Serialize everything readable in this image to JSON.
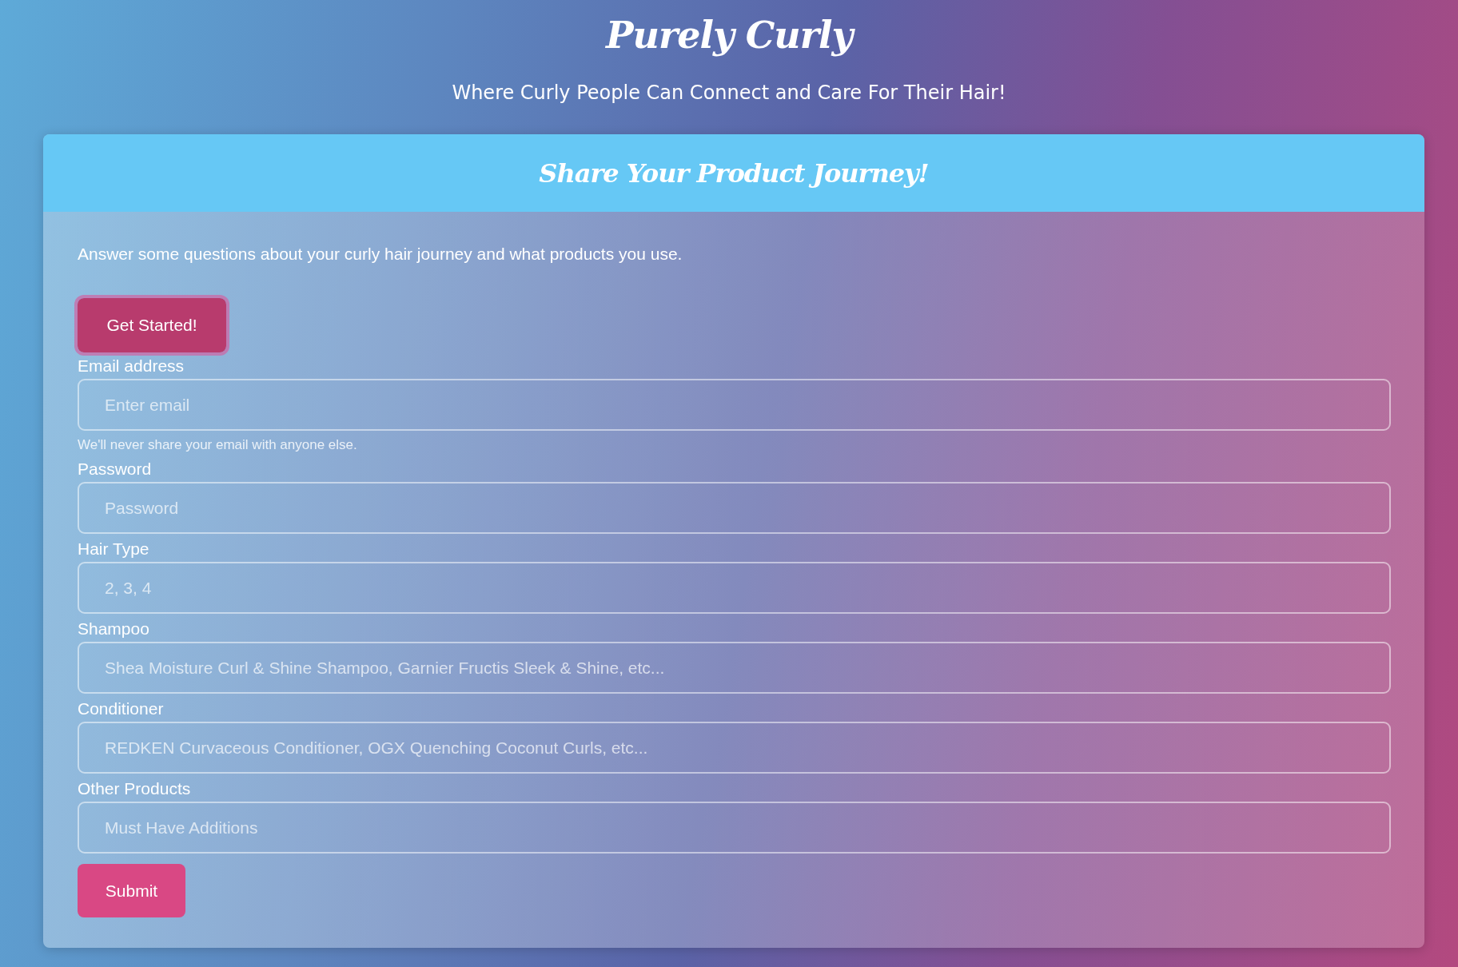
{
  "header": {
    "title": "Purely Curly",
    "subtitle": "Where Curly People Can Connect and Care For Their Hair!"
  },
  "card": {
    "title": "Share Your Product Journey!",
    "intro": "Answer some questions about your curly hair journey and what products you use.",
    "start_button": {
      "label": "Get Started!",
      "focused": true
    },
    "fields": [
      {
        "label": "Email address",
        "placeholder": "Enter email",
        "hint": "We'll never share your email with anyone else."
      },
      {
        "label": "Password",
        "placeholder": "Password"
      },
      {
        "label": "Hair Type",
        "placeholder": "2, 3, 4"
      },
      {
        "label": "Shampoo",
        "placeholder": "Shea Moisture Curl & Shine Shampoo, Garnier Fructis Sleek & Shine, etc..."
      },
      {
        "label": "Conditioner",
        "placeholder": "REDKEN Curvaceous Conditioner, OGX Quenching Coconut Curls, etc..."
      },
      {
        "label": "Other Products",
        "placeholder": "Must Have Additions"
      }
    ],
    "submit_button": {
      "label": "Submit"
    }
  }
}
